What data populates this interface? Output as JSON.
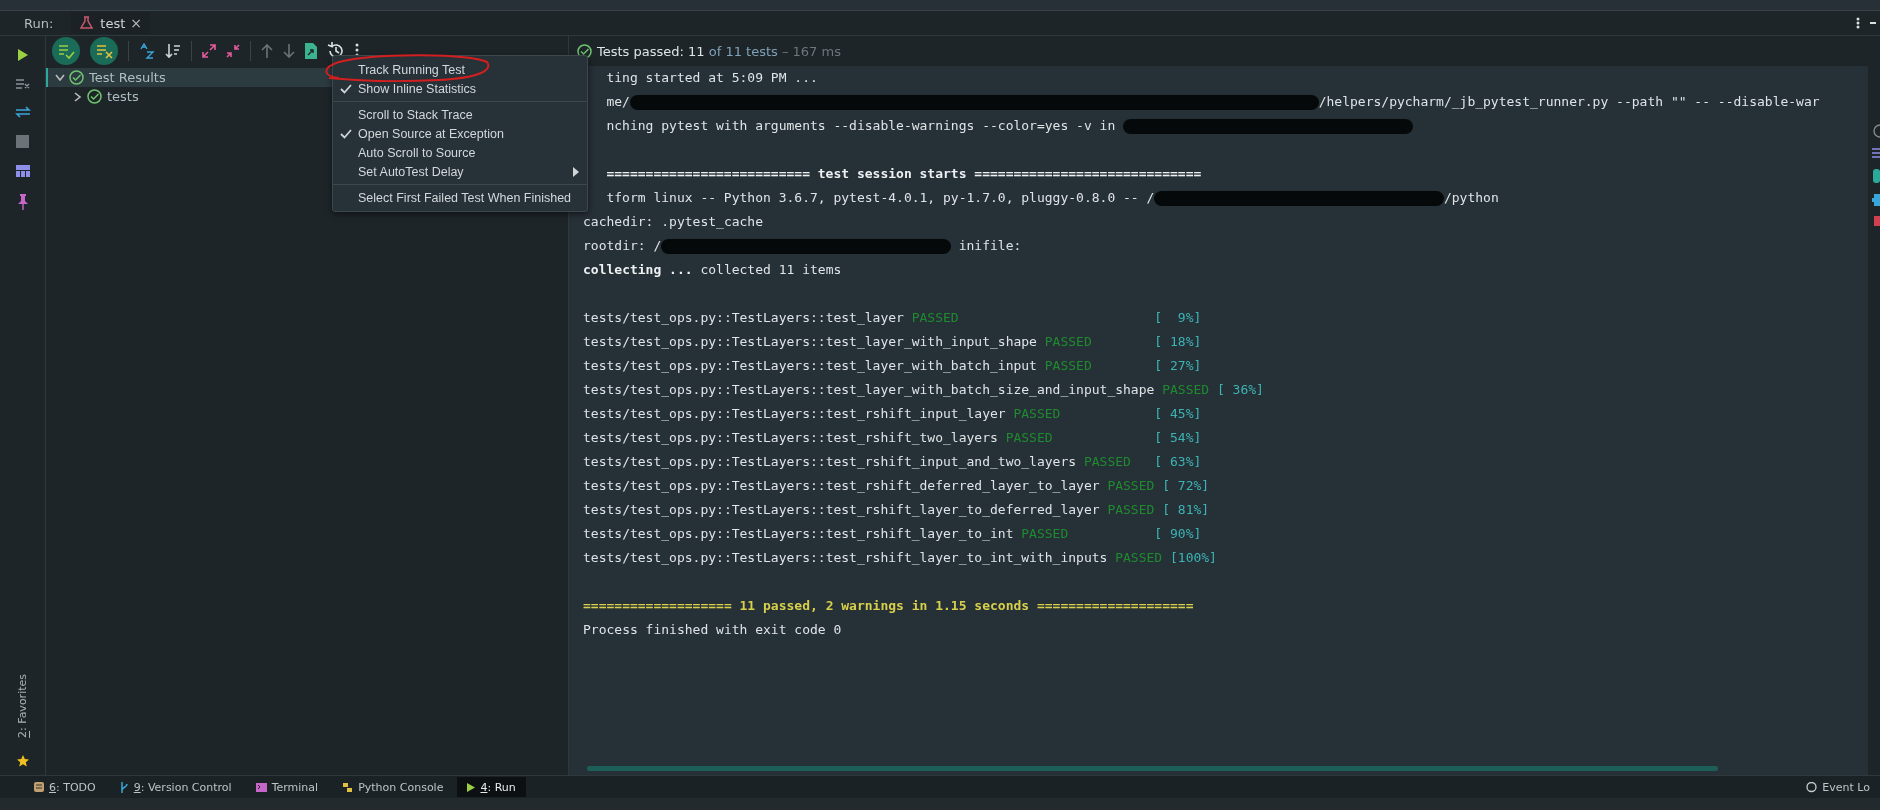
{
  "run_bar": {
    "label": "Run:",
    "tab": {
      "label": "test",
      "close_glyph": "×"
    }
  },
  "tree": [
    {
      "label": "Test Results",
      "selected": true,
      "expanded": true,
      "children": [
        {
          "label": "tests",
          "selected": false,
          "expanded": false
        }
      ]
    }
  ],
  "menu": [
    {
      "kind": "item",
      "label": "Track Running Test",
      "checked": false,
      "highlighted": true
    },
    {
      "kind": "item",
      "label": "Show Inline Statistics",
      "checked": true,
      "highlighted": false
    },
    {
      "kind": "separator"
    },
    {
      "kind": "item",
      "label": "Scroll to Stack Trace",
      "checked": false,
      "highlighted": false
    },
    {
      "kind": "item",
      "label": "Open Source at Exception",
      "checked": true,
      "highlighted": false
    },
    {
      "kind": "item",
      "label": "Auto Scroll to Source",
      "checked": false,
      "highlighted": false
    },
    {
      "kind": "submenu",
      "label": "Set AutoTest Delay",
      "checked": false,
      "highlighted": false
    },
    {
      "kind": "separator"
    },
    {
      "kind": "item",
      "label": "Select First Failed Test When Finished",
      "checked": false,
      "highlighted": false
    }
  ],
  "status_header": [
    "Tests passed: 11",
    "of 11 tests",
    "– 167 ms"
  ],
  "console": [
    {
      "kind": "cut",
      "segments": [
        {
          "kind": "text",
          "text": "ting started at 5:09 PM ..."
        }
      ]
    },
    {
      "kind": "cut",
      "segments": [
        {
          "kind": "text",
          "text": "me/"
        },
        {
          "kind": "blackout"
        },
        {
          "kind": "text",
          "text": "/helpers/pycharm/_jb_pytest_runner.py --path \"\" -- --disable-war"
        }
      ]
    },
    {
      "kind": "cut",
      "segments": [
        {
          "kind": "text",
          "text": "nching pytest with arguments --disable-warnings --color=yes -v in "
        },
        {
          "kind": "redaction"
        }
      ]
    },
    {
      "kind": "blank"
    },
    {
      "kind": "cut",
      "segments": [
        {
          "kind": "bold",
          "text": "========================== test session starts ============================="
        }
      ]
    },
    {
      "kind": "cut",
      "segments": [
        {
          "kind": "text",
          "text": "tform linux -- Python 3.6.7, pytest-4.0.1, py-1.7.0, pluggy-0.8.0 -- /"
        },
        {
          "kind": "redaction"
        },
        {
          "kind": "text",
          "text": "/python"
        }
      ]
    },
    {
      "kind": "full",
      "segments": [
        {
          "kind": "text",
          "text": "cachedir: .pytest_cache"
        }
      ]
    },
    {
      "kind": "full",
      "segments": [
        {
          "kind": "text",
          "text": "rootdir: /"
        },
        {
          "kind": "redaction"
        },
        {
          "kind": "text",
          "text": " inifile:"
        }
      ]
    },
    {
      "kind": "full",
      "segments": [
        {
          "kind": "bold",
          "text": "collecting ..."
        },
        {
          "kind": "text",
          "text": " collected 11 items"
        }
      ]
    },
    {
      "kind": "blank"
    }
  ],
  "results": [
    {
      "name": "tests/test_ops.py::TestLayers::test_layer",
      "status": "PASSED",
      "progress": "[  9%]"
    },
    {
      "name": "tests/test_ops.py::TestLayers::test_layer_with_input_shape",
      "status": "PASSED",
      "progress": "[ 18%]"
    },
    {
      "name": "tests/test_ops.py::TestLayers::test_layer_with_batch_input",
      "status": "PASSED",
      "progress": "[ 27%]"
    },
    {
      "name": "tests/test_ops.py::TestLayers::test_layer_with_batch_size_and_input_shape",
      "status": "PASSED",
      "progress": "[ 36%]"
    },
    {
      "name": "tests/test_ops.py::TestLayers::test_rshift_input_layer",
      "status": "PASSED",
      "progress": "[ 45%]"
    },
    {
      "name": "tests/test_ops.py::TestLayers::test_rshift_two_layers",
      "status": "PASSED",
      "progress": "[ 54%]"
    },
    {
      "name": "tests/test_ops.py::TestLayers::test_rshift_input_and_two_layers",
      "status": "PASSED",
      "progress": "[ 63%]"
    },
    {
      "name": "tests/test_ops.py::TestLayers::test_rshift_deferred_layer_to_layer",
      "status": "PASSED",
      "progress": "[ 72%]"
    },
    {
      "name": "tests/test_ops.py::TestLayers::test_rshift_layer_to_deferred_layer",
      "status": "PASSED",
      "progress": "[ 81%]"
    },
    {
      "name": "tests/test_ops.py::TestLayers::test_rshift_layer_to_int",
      "status": "PASSED",
      "progress": "[ 90%]"
    },
    {
      "name": "tests/test_ops.py::TestLayers::test_rshift_layer_to_int_with_inputs",
      "status": "PASSED",
      "progress": "[100%]"
    }
  ],
  "summary": "=================== 11 passed, 2 warnings in 1.15 seconds ====================",
  "exit_line": "Process finished with exit code 0",
  "favorites": {
    "mnemonic": "2",
    "label": ": Favorites"
  },
  "tool_windows": [
    {
      "kind": "todo",
      "mnemonic": "6",
      "label": ": TODO",
      "selected": false
    },
    {
      "kind": "branch",
      "mnemonic": "9",
      "label": ": Version Control",
      "selected": false
    },
    {
      "kind": "terminal",
      "label": "Terminal",
      "selected": false
    },
    {
      "kind": "python",
      "label": "Python Console",
      "selected": false
    },
    {
      "kind": "run",
      "mnemonic": "4",
      "label": ": Run",
      "selected": true
    }
  ],
  "event_log": "Event Lo"
}
